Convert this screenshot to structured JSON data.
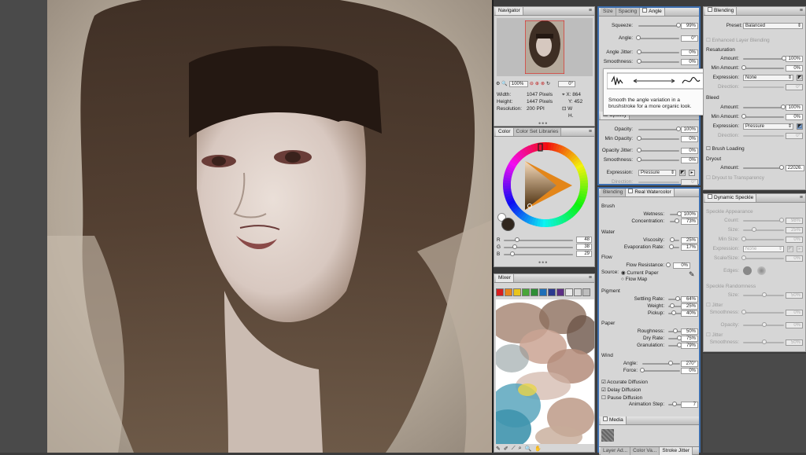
{
  "navigator": {
    "title": "Navigator",
    "zoom": "100%",
    "rotation": "0°",
    "width_label": "Width:",
    "width": "1047 Pixels",
    "height_label": "Height:",
    "height": "1447 Pixels",
    "res_label": "Resolution:",
    "resolution": "200 PPI",
    "x_label": "X:",
    "x": "864",
    "y_label": "Y:",
    "y": "452",
    "w_label": "W",
    "h_label": "H."
  },
  "color": {
    "tabs": [
      "Color",
      "Color Set Libraries"
    ],
    "r_label": "R",
    "g_label": "G",
    "b_label": "B",
    "r": "48",
    "g": "38",
    "b": "29"
  },
  "mixer": {
    "title": "Mixer",
    "swatches": [
      "#d81f1f",
      "#e8861c",
      "#e9c51c",
      "#4aa63a",
      "#2f8e36",
      "#1e6fb8",
      "#2a3a8f",
      "#5c2f84",
      "#e9e9e9",
      "#d9d9d9",
      "#bdbdbd"
    ]
  },
  "stroke_panel": {
    "tabs": [
      "Size",
      "Spacing",
      "Angle"
    ],
    "squeeze_label": "Squeeze:",
    "squeeze": "99%",
    "squeeze_level": 0.99,
    "angle_label": "Angle:",
    "angle": "0°",
    "angle_level": 0.0,
    "angle_jitter_label": "Angle Jitter:",
    "angle_jitter": "0%",
    "smoothness_label": "Smoothness:",
    "smoothness": "0%",
    "tooltip": "Smooth the angle variation in a brushstroke for a more organic look.",
    "opacity_tab": "Opacity",
    "opacity_label": "Opacity:",
    "opacity": "100%",
    "min_opacity_label": "Min Opacity:",
    "min_opacity": "0%",
    "opacity_jitter_label": "Opacity Jitter:",
    "opacity_jitter": "0%",
    "op_smooth_label": "Smoothness:",
    "op_smooth": "0%",
    "expression_label": "Expression:",
    "expression": "Pressure",
    "direction_label": "Direction:",
    "direction": "0°"
  },
  "watercolor": {
    "tabs": [
      "Blending",
      "Real Watercolor"
    ],
    "brush": "Brush",
    "wetness_label": "Wetness:",
    "wetness": "100%",
    "wetness_level": 1.0,
    "concentration_label": "Concentration:",
    "concentration": "73%",
    "concentration_level": 0.73,
    "water": "Water",
    "viscosity_label": "Viscosity:",
    "viscosity": "25%",
    "viscosity_level": 0.25,
    "evaporation_label": "Evaporation Rate:",
    "evaporation": "17%",
    "evaporation_level": 0.17,
    "flow": "Flow",
    "flow_resistance_label": "Flow Resistance:",
    "flow_resistance": "0%",
    "source_label": "Source:",
    "current_paper": "Current Paper",
    "flow_map": "Flow Map",
    "pigment": "Pigment",
    "settling_label": "Settling Rate:",
    "settling": "64%",
    "settling_level": 0.64,
    "weight_label": "Weight:",
    "weight": "25%",
    "weight_level": 0.25,
    "pickup_label": "Pickup:",
    "pickup": "40%",
    "pickup_level": 0.4,
    "paper": "Paper",
    "roughness_label": "Roughness:",
    "roughness": "50%",
    "roughness_level": 0.5,
    "dry_rate_label": "Dry Rate:",
    "dry_rate": "75%",
    "dry_rate_level": 0.75,
    "granulation_label": "Granulation:",
    "granulation": "79%",
    "granulation_level": 0.79,
    "wind": "Wind",
    "wind_angle_label": "Angle:",
    "wind_angle": "270°",
    "wind_angle_level": 0.75,
    "force_label": "Force:",
    "force": "0%",
    "force_level": 0.0,
    "accurate_diffusion": "Accurate Diffusion",
    "delay_diffusion": "Delay Diffusion",
    "pause_diffusion": "Pause Diffusion",
    "animation_step_label": "Animation Step:",
    "animation_step": "7",
    "animation_step_level": 0.45,
    "media": "Media",
    "bottom_tabs": [
      "Layer Ad...",
      "Color Va...",
      "Stroke Jitter"
    ]
  },
  "blending": {
    "title": "Blending",
    "preset_label": "Preset:",
    "preset": "Balanced",
    "enhanced": "Enhanced Layer Blending",
    "resaturation": "Resaturation",
    "amount_label": "Amount:",
    "amount": "100%",
    "amount_level": 1.0,
    "min_amount_label": "Min Amount:",
    "min_amount": "0%",
    "expression_label": "Expression:",
    "expression": "None",
    "direction_label": "Direction:",
    "direction": "0°",
    "bleed": "Bleed",
    "bleed_amount": "100%",
    "bleed_min": "0%",
    "bleed_expression": "Pressure",
    "bleed_direction": "0°",
    "brush_loading": "Brush Loading",
    "dryout": "Dryout",
    "dry_amount": "22026.",
    "dryout_transparency": "Dryout to Transparency"
  },
  "speckle": {
    "title": "Dynamic Speckle",
    "appearance": "Speckle Appearance",
    "count_label": "Count:",
    "count": "98%",
    "size_label": "Size:",
    "size": "25%",
    "min_size_label": "Min Size:",
    "min_size": "0%",
    "expression_label": "Expression:",
    "expression": "None",
    "scale_size_label": "Scale/Size:",
    "scale_size": "0%",
    "edges_label": "Edges:",
    "randomness": "Speckle Randomness",
    "r_size": "50%",
    "jitter": "Jitter",
    "r_smooth_label": "Smoothness:",
    "r_smooth": "0%",
    "opacity_label": "Opacity:",
    "opacity": "0%",
    "jitter2": "Jitter",
    "r_smooth2": "50%"
  }
}
